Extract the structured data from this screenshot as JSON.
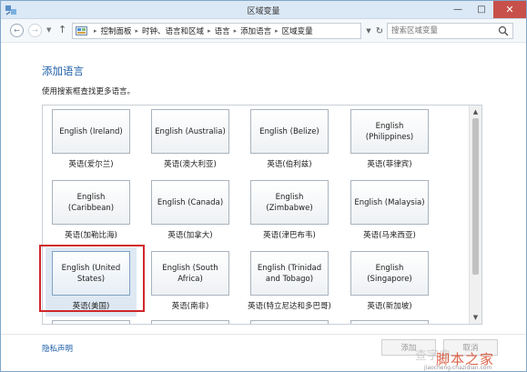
{
  "window": {
    "title": "区域变量"
  },
  "address": {
    "crumbs": [
      "控制面板",
      "时钟、语言和区域",
      "语言",
      "添加语言",
      "区域变量"
    ],
    "search_placeholder": "搜索区域变量"
  },
  "content": {
    "heading": "添加语言",
    "subtext": "使用搜索框查找更多语言。"
  },
  "languages": [
    {
      "tile": "English (Ireland)",
      "name": "英语(爱尔兰)",
      "selected": false
    },
    {
      "tile": "English (Australia)",
      "name": "英语(澳大利亚)",
      "selected": false
    },
    {
      "tile": "English (Belize)",
      "name": "英语(伯利兹)",
      "selected": false
    },
    {
      "tile": "English (Philippines)",
      "name": "英语(菲律宾)",
      "selected": false
    },
    {
      "tile": "English (Caribbean)",
      "name": "英语(加勒比海)",
      "selected": false
    },
    {
      "tile": "English (Canada)",
      "name": "英语(加拿大)",
      "selected": false
    },
    {
      "tile": "English (Zimbabwe)",
      "name": "英语(津巴布韦)",
      "selected": false
    },
    {
      "tile": "English (Malaysia)",
      "name": "英语(马来西亚)",
      "selected": false
    },
    {
      "tile": "English (United States)",
      "name": "英语(美国)",
      "selected": true
    },
    {
      "tile": "English (South Africa)",
      "name": "英语(南非)",
      "selected": false
    },
    {
      "tile": "English (Trinidad and Tobago)",
      "name": "英语(特立尼达和多巴哥)",
      "selected": false
    },
    {
      "tile": "English (Singapore)",
      "name": "英语(新加坡)",
      "selected": false
    }
  ],
  "footer": {
    "privacy_link": "隐私声明",
    "add_button": "添加",
    "cancel_button": "取消"
  },
  "watermark": {
    "main": "脚本之家",
    "left": "查字典",
    "url": "jiaocheng.chazidian.com"
  },
  "colors": {
    "accent": "#1e5fa8",
    "highlight": "#d0262a",
    "close": "#c7504a"
  },
  "icons": [
    "app-icon",
    "back-arrow-icon",
    "forward-arrow-icon",
    "up-arrow-icon",
    "control-panel-icon",
    "refresh-icon",
    "search-icon"
  ]
}
